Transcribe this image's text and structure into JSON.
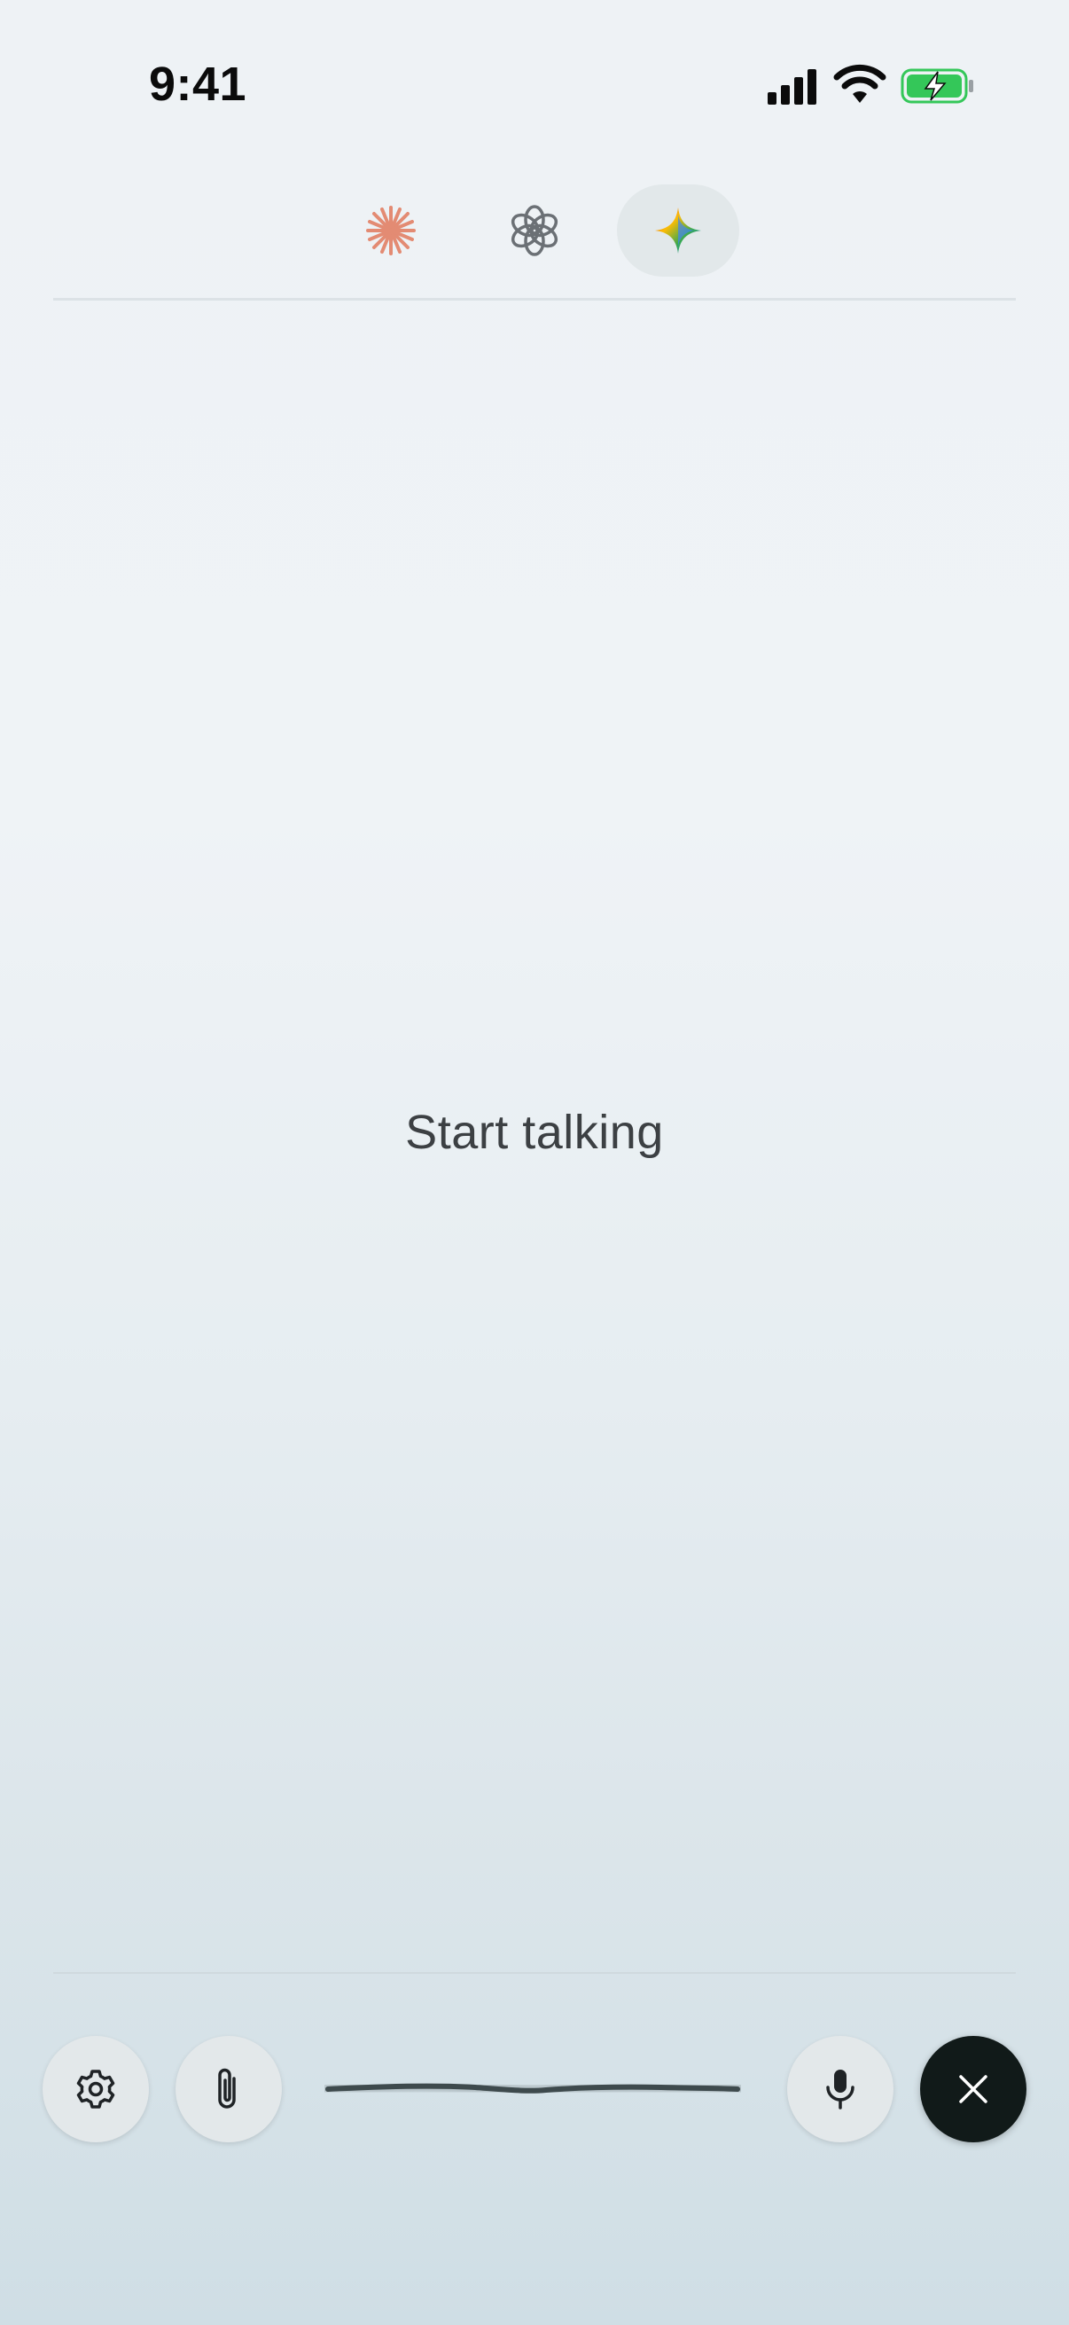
{
  "status_bar": {
    "time": "9:41"
  },
  "models": [
    {
      "name": "claude",
      "icon": "claude-sparkle-icon",
      "color": "#e07a5f",
      "active": false
    },
    {
      "name": "chatgpt",
      "icon": "openai-knot-icon",
      "color": "#6b7075",
      "active": false
    },
    {
      "name": "gemini",
      "icon": "gemini-star-icon",
      "color": "#4285f4",
      "active": true
    }
  ],
  "main": {
    "prompt": "Start talking"
  },
  "controls": {
    "settings_icon": "gear-icon",
    "attach_icon": "paperclip-icon",
    "mic_icon": "microphone-icon",
    "close_icon": "close-icon"
  },
  "colors": {
    "accent_dark": "#111a19",
    "button_bg": "#e3e8ea",
    "battery_green": "#34c759"
  }
}
